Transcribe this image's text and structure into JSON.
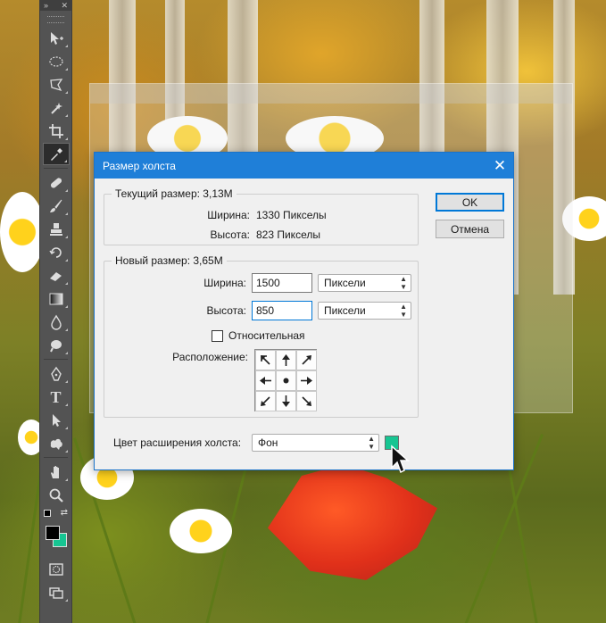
{
  "dialog": {
    "title": "Размер холста",
    "close_glyph": "✕",
    "current_size": {
      "legend": "Текущий размер:  3,13M",
      "width_label": "Ширина:",
      "width_value": "1330 Пикселы",
      "height_label": "Высота:",
      "height_value": "823 Пикселы"
    },
    "new_size": {
      "legend": "Новый размер: 3,65M",
      "width_label": "Ширина:",
      "width_value": "1500",
      "width_unit": "Пиксели",
      "height_label": "Высота:",
      "height_value": "850",
      "height_unit": "Пиксели",
      "relative_label": "Относительная",
      "relative_checked": false,
      "anchor_label": "Расположение:",
      "anchor_selected": "center"
    },
    "extension_color": {
      "label": "Цвет расширения холста:",
      "value": "Фон",
      "swatch_color": "#17c592"
    },
    "ok_label": "OK",
    "cancel_label": "Отмена"
  },
  "toolbar": {
    "collapse_glyph": "»",
    "close_glyph": "✕",
    "tools": [
      "move-tool",
      "marquee-tool",
      "lasso-tool",
      "magic-wand-tool",
      "crop-tool",
      "eyedropper-tool",
      "healing-brush-tool",
      "brush-tool",
      "clone-stamp-tool",
      "history-brush-tool",
      "eraser-tool",
      "gradient-tool",
      "blur-tool",
      "dodge-tool",
      "pen-tool",
      "type-tool",
      "path-selection-tool",
      "custom-shape-tool",
      "hand-tool",
      "zoom-tool"
    ],
    "active_tool": "eyedropper-tool",
    "type_tool_glyph": "T",
    "foreground_color": "#000000",
    "background_color": "#17c592"
  }
}
